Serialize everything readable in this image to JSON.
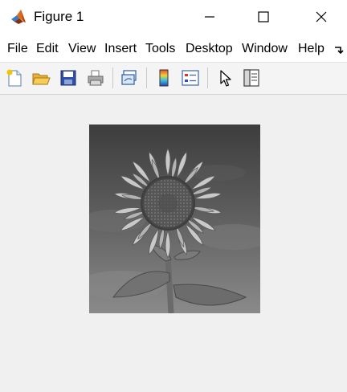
{
  "window": {
    "title": "Figure 1",
    "icon": "matlab-icon",
    "controls": [
      "minimize-icon",
      "maximize-icon",
      "close-icon"
    ]
  },
  "menubar": {
    "items": [
      "File",
      "Edit",
      "View",
      "Insert",
      "Tools",
      "Desktop",
      "Window",
      "Help"
    ],
    "overflow_icon": "chevron-overflow-icon"
  },
  "toolbar": {
    "buttons": [
      "new-figure-icon",
      "open-file-icon",
      "save-icon",
      "print-icon",
      "link-plot-icon",
      "insert-colorbar-icon",
      "insert-legend-icon",
      "edit-plot-cursor-icon",
      "property-inspector-icon"
    ]
  },
  "figure": {
    "image": "grayscale-sunflower-photo"
  },
  "colors": {
    "background": "#f0f0f0",
    "titlebar": "#ffffff"
  }
}
